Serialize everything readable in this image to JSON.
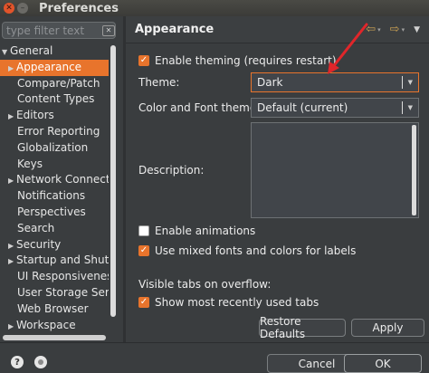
{
  "window": {
    "title": "Preferences",
    "close_glyph": "✕",
    "min_glyph": "–"
  },
  "sidebar": {
    "filter_placeholder": "type filter text",
    "clear_glyph": "✕",
    "items": [
      {
        "label": "General",
        "expanded": true
      },
      {
        "label": "Appearance",
        "selected": true,
        "arrow": true
      },
      {
        "label": "Compare/Patch"
      },
      {
        "label": "Content Types"
      },
      {
        "label": "Editors",
        "arrow": true
      },
      {
        "label": "Error Reporting"
      },
      {
        "label": "Globalization"
      },
      {
        "label": "Keys"
      },
      {
        "label": "Network Connection",
        "arrow": true
      },
      {
        "label": "Notifications"
      },
      {
        "label": "Perspectives"
      },
      {
        "label": "Search"
      },
      {
        "label": "Security",
        "arrow": true
      },
      {
        "label": "Startup and Shutdown",
        "arrow": true
      },
      {
        "label": "UI Responsiveness M"
      },
      {
        "label": "User Storage Servic"
      },
      {
        "label": "Web Browser"
      },
      {
        "label": "Workspace",
        "arrow": true
      }
    ]
  },
  "header": {
    "title": "Appearance",
    "back_icon": "⇦",
    "forward_icon": "⇨",
    "drop_glyph": "▾",
    "menu_glyph": "▼"
  },
  "appearance": {
    "enable_theming_label": "Enable theming (requires restart)",
    "theme_label": "Theme:",
    "theme_value": "Dark",
    "color_font_label": "Color and Font theme:",
    "color_font_value": "Default (current)",
    "description_label": "Description:",
    "enable_animations_label": "Enable animations",
    "mixed_fonts_label": "Use mixed fonts and colors for labels",
    "visible_tabs_label": "Visible tabs on overflow:",
    "show_recent_tabs_label": "Show most recently used tabs",
    "check_glyph": "✓",
    "dropdown_glyph": "▼",
    "restore_defaults_label": "Restore Defaults",
    "apply_label": "Apply"
  },
  "states": {
    "enable_theming": true,
    "enable_animations": false,
    "mixed_fonts": true,
    "show_recent_tabs": true
  },
  "footer": {
    "help_glyph": "?",
    "cancel_label": "Cancel",
    "ok_label": "OK"
  },
  "colors": {
    "accent": "#e8742c",
    "background": "#3a3d3f",
    "annotation_arrow": "#e0262a"
  }
}
